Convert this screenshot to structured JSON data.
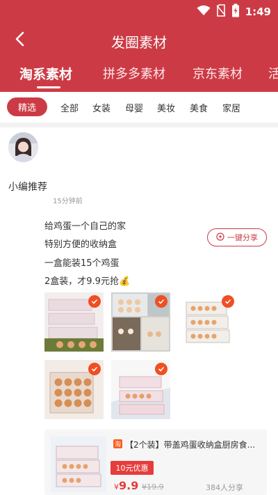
{
  "status_bar": {
    "time": "1:49"
  },
  "header": {
    "title": "发圈素材"
  },
  "tabs": [
    {
      "label": "淘系素材"
    },
    {
      "label": "拼多多素材"
    },
    {
      "label": "京东素材"
    },
    {
      "label": "活"
    }
  ],
  "categories": {
    "selected": "精选",
    "items": [
      "全部",
      "女装",
      "母婴",
      "美妆",
      "美食",
      "家居"
    ]
  },
  "post": {
    "author": "小编推荐",
    "time": "15分钟前",
    "lines": [
      "给鸡蛋一个自己的家",
      "特别方便的收纳盒",
      "一盒能装15个鸡蛋",
      "2盒装，才9.9元抢💰"
    ],
    "share_label": "一键分享"
  },
  "product": {
    "platform": "淘",
    "title": "【2个装】带盖鸡蛋收纳盒厨房食...",
    "coupon": "10元优惠",
    "currency": "¥",
    "price": "9.9",
    "original_price": "¥19.9",
    "shares": "384人分享"
  },
  "colors": {
    "brand": "#cc3b45",
    "check": "#ef4f23"
  }
}
